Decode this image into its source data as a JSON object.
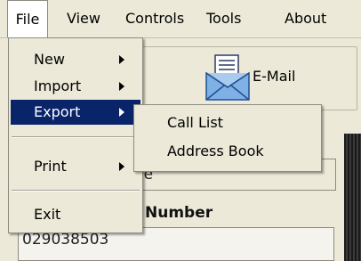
{
  "menubar": {
    "items": [
      {
        "label": "File"
      },
      {
        "label": "View"
      },
      {
        "label": "Controls"
      },
      {
        "label": "Tools"
      },
      {
        "label": "About"
      }
    ]
  },
  "file_menu": {
    "items": [
      {
        "label": "New",
        "submenu": true
      },
      {
        "label": "Import",
        "submenu": true
      },
      {
        "label": "Export",
        "submenu": true,
        "selected": true
      },
      {
        "label": "Print",
        "submenu": true
      },
      {
        "label": "Exit",
        "submenu": false
      }
    ]
  },
  "export_submenu": {
    "items": [
      {
        "label": "Call List"
      },
      {
        "label": "Address Book"
      }
    ]
  },
  "toolbar": {
    "email_label": "E-Mail",
    "email_icon": "email-icon"
  },
  "form": {
    "top_field_fragment": "re",
    "number_label": "Number",
    "number_value": "029038503"
  },
  "colors": {
    "selection": "#0a246a",
    "window": "#ece9d8"
  }
}
